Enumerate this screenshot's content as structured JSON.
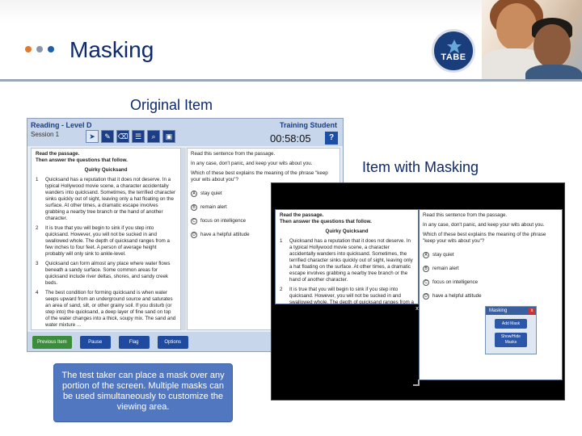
{
  "slide": {
    "title": "Masking",
    "dot_colors": [
      "#e07a2e",
      "#8a96a8",
      "#1b5fae"
    ],
    "logo_text": "TABE",
    "label_original": "Original Item",
    "label_masked": "Item with Masking",
    "caption": "The test taker can place a mask over any portion of the screen. Multiple masks can be used simultaneously to customize the viewing area."
  },
  "original": {
    "subject": "Reading - Level D",
    "session": "Session 1",
    "student": "Training Student",
    "timer": "00:58:05",
    "help": "?",
    "tool_icons": [
      "pointer-icon",
      "highlighter-icon",
      "eraser-icon",
      "notes-icon",
      "magnifier-icon",
      "mask-icon"
    ],
    "passage": {
      "instructions_1": "Read the passage.",
      "instructions_2": "Then answer the questions that follow.",
      "title": "Quirky Quicksand",
      "paragraphs": [
        {
          "n": "1",
          "text": "Quicksand has a reputation that it does not deserve. In a typical Hollywood movie scene, a character accidentally wanders into quicksand. Sometimes, the terrified character sinks quickly out of sight, leaving only a hat floating on the surface. At other times, a dramatic escape involves grabbing a nearby tree branch or the hand of another character."
        },
        {
          "n": "2",
          "text": "It is true that you will begin to sink if you step into quicksand. However, you will not be sucked in and swallowed whole. The depth of quicksand ranges from a few inches to four feet. A person of average height probably will only sink to ankle-level."
        },
        {
          "n": "3",
          "text": "Quicksand can form almost any place where water flows beneath a sandy surface. Some common areas for quicksand include river deltas, shores, and sandy creek beds."
        },
        {
          "n": "4",
          "text": "The best condition for forming quicksand is when water seeps upward from an underground source and saturates an area of sand, silt, or other grainy soil. If you disturb (or step into) the quicksand, a deep layer of fine sand on top of the water changes into a thick, soupy mix. The sand and water mixture ..."
        }
      ]
    },
    "question": {
      "prompt": "Read this sentence from the passage.",
      "quote": "In any case, don't panic, and keep your wits about you.",
      "stem": "Which of these best explains the meaning of the phrase \"keep your wits about you\"?",
      "choices": [
        {
          "letter": "A",
          "text": "stay quiet"
        },
        {
          "letter": "B",
          "text": "remain alert"
        },
        {
          "letter": "C",
          "text": "focus on intelligence"
        },
        {
          "letter": "D",
          "text": "have a helpful attitude"
        }
      ]
    },
    "buttons": {
      "previous": "Previous Item",
      "pause": "Pause",
      "flag": "Flag",
      "options": "Options"
    }
  },
  "masked": {
    "panel_title": "Masking",
    "panel_close": "x",
    "add_mask": "Add Mask",
    "show_hide_line1": "Show/Hide",
    "show_hide_line2": "Masks",
    "mask_close": "x",
    "paragraph_2_short": "It is true that you will begin to sink if you step into quicksand. However, you will not be sucked in and swallowed whole. The depth of quicksand ranges from a few inches to four feet. A person of average height"
  }
}
